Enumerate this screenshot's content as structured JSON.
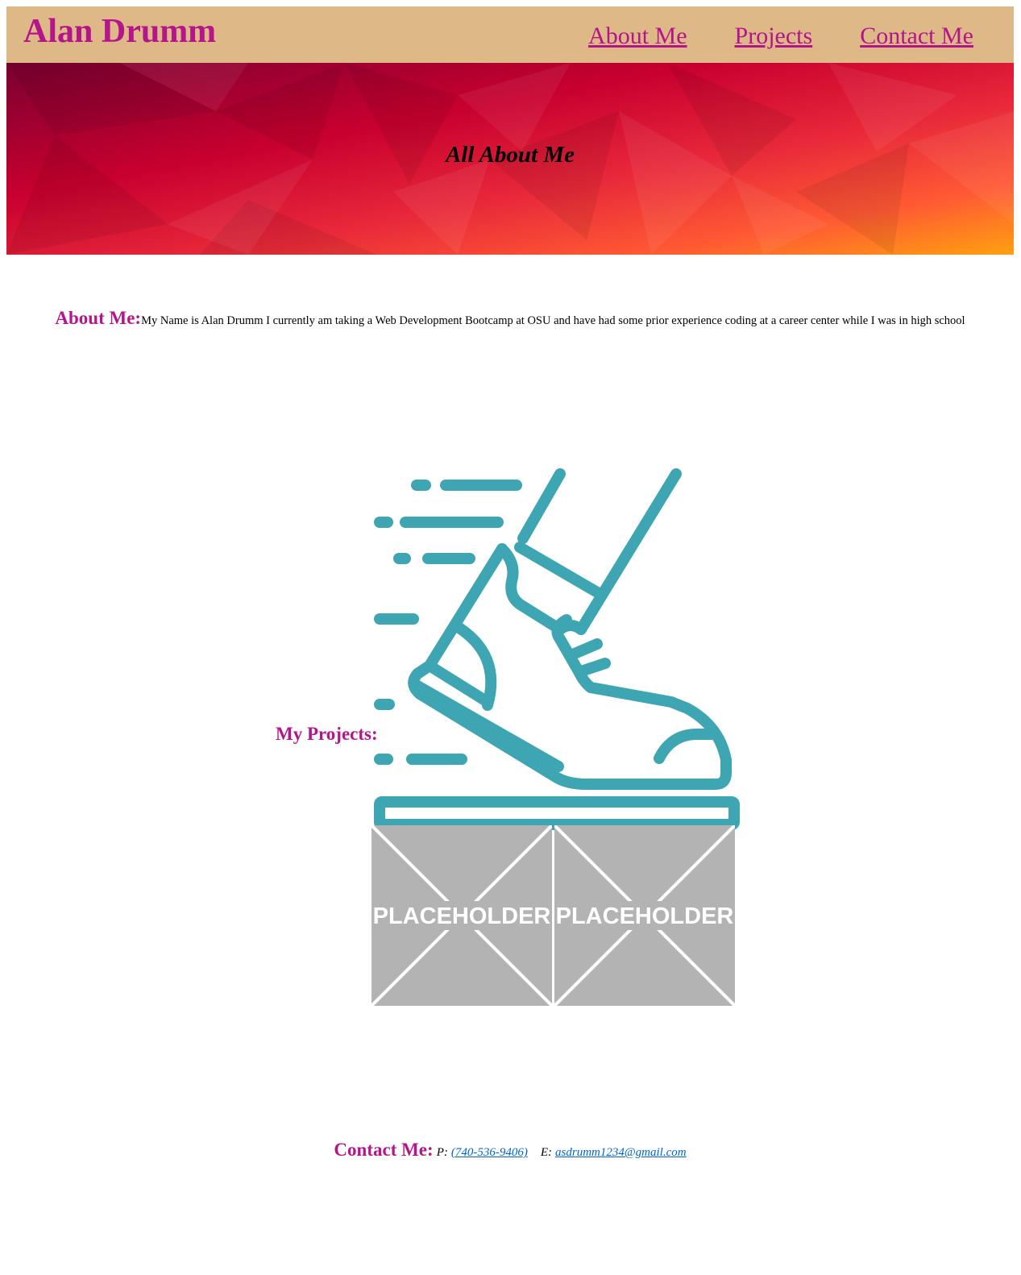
{
  "header": {
    "site_title": "Alan Drumm",
    "nav": [
      {
        "label": "About Me"
      },
      {
        "label": "Projects"
      },
      {
        "label": "Contact Me"
      }
    ]
  },
  "hero": {
    "title": "All About Me"
  },
  "about": {
    "label": "About Me:",
    "text": "My Name is Alan Drumm I currently am taking a Web Development Bootcamp at OSU and have had some prior experience coding at a career center while I was in high school"
  },
  "projects": {
    "label": "My Projects:",
    "images": [
      {
        "icon": "running-shoe-icon"
      },
      {
        "caption": "PLACEHOLDER"
      },
      {
        "caption": "PLACEHOLDER"
      }
    ]
  },
  "contact": {
    "label": "Contact Me:",
    "phone_prefix": "P:",
    "phone": "(740-536-9406)",
    "email_prefix": "E:",
    "email": "asdrumm1234@gmail.com"
  },
  "colors": {
    "header_bg": "#deb887",
    "accent": "#b5158b",
    "icon": "#3ea6b2",
    "placeholder": "#b3b3b3",
    "link": "#0066cc"
  }
}
